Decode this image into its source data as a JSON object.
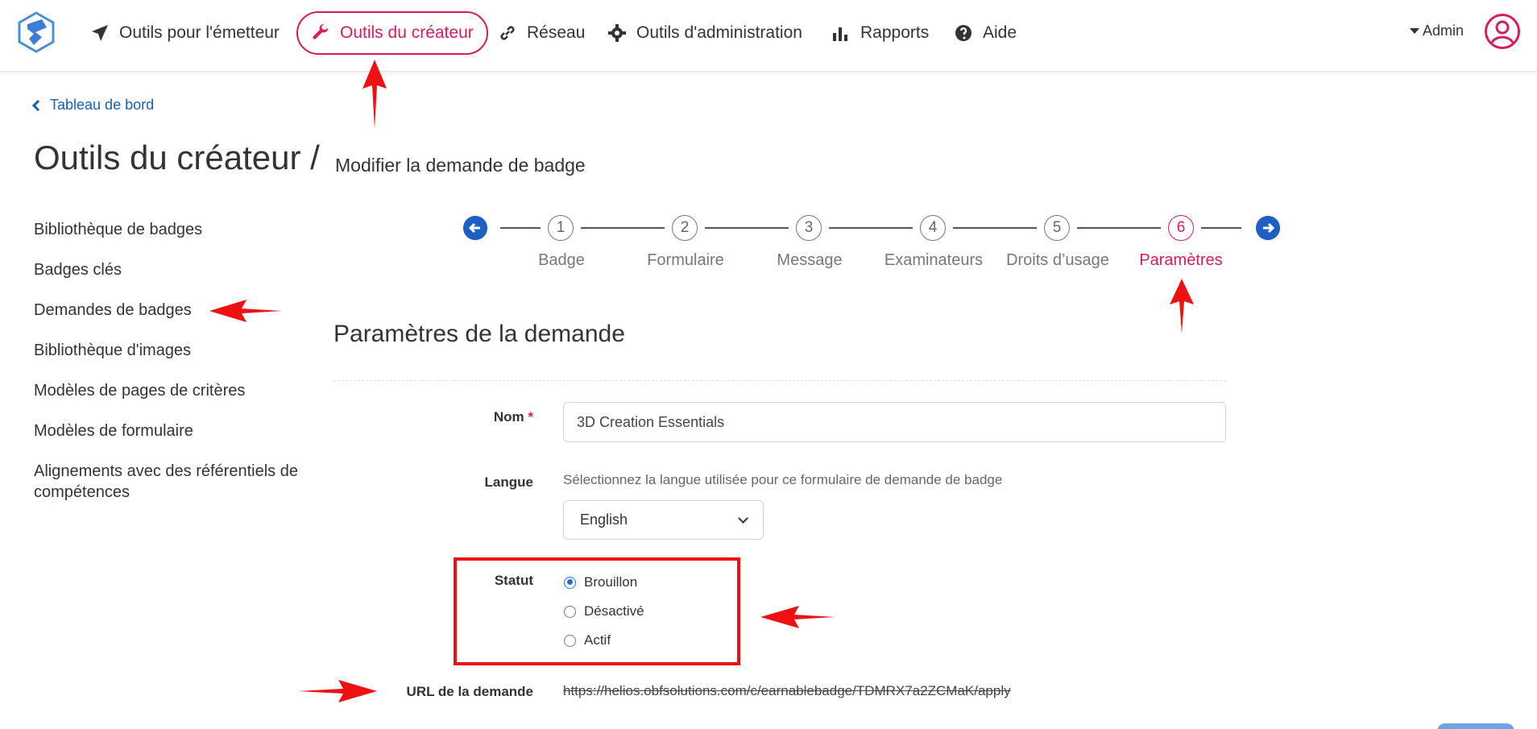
{
  "nav": {
    "items": [
      {
        "label": "Outils pour l'émetteur",
        "icon": "paper-plane-icon"
      },
      {
        "label": "Outils du créateur",
        "icon": "wrench-icon",
        "active": true
      },
      {
        "label": "Réseau",
        "icon": "link-icon"
      },
      {
        "label": "Outils d'administration",
        "icon": "gear-icon"
      },
      {
        "label": "Rapports",
        "icon": "bar-chart-icon"
      },
      {
        "label": "Aide",
        "icon": "question-circle-icon"
      }
    ],
    "user": "Admin"
  },
  "breadcrumb": {
    "back_label": "Tableau de bord"
  },
  "page": {
    "title": "Outils du créateur /",
    "subtitle": "Modifier la demande de badge"
  },
  "sidebar": {
    "items": [
      {
        "label": "Bibliothèque de badges"
      },
      {
        "label": "Badges clés"
      },
      {
        "label": "Demandes de badges"
      },
      {
        "label": "Bibliothèque d'images"
      },
      {
        "label": "Modèles de pages de critères"
      },
      {
        "label": "Modèles de formulaire"
      },
      {
        "label": "Alignements avec des référentiels de compétences"
      }
    ]
  },
  "stepper": {
    "steps": [
      {
        "number": "1",
        "label": "Badge"
      },
      {
        "number": "2",
        "label": "Formulaire"
      },
      {
        "number": "3",
        "label": "Message"
      },
      {
        "number": "4",
        "label": "Examinateurs"
      },
      {
        "number": "5",
        "label": "Droits d’usage"
      },
      {
        "number": "6",
        "label": "Paramètres",
        "active": true
      }
    ]
  },
  "section": {
    "title": "Paramètres de la demande"
  },
  "form": {
    "name_label": "Nom",
    "required_mark": "*",
    "name_value": "3D Creation Essentials",
    "language_label": "Langue",
    "language_help": "Sélectionnez la langue utilisée pour ce formulaire de demande de badge",
    "language_value": "English",
    "status_label": "Statut",
    "status_options": [
      {
        "label": "Brouillon",
        "checked": true
      },
      {
        "label": "Désactivé",
        "checked": false
      },
      {
        "label": "Actif",
        "checked": false
      }
    ],
    "url_label": "URL de la demande",
    "url_value": "https://helios.obfsolutions.com/c/earnablebadge/TDMRX7a2ZCMaK/apply"
  },
  "colors": {
    "accent": "#d81b60",
    "link": "#1a5fb4",
    "primary": "#1d5fc5",
    "annotation": "#ee1111"
  }
}
